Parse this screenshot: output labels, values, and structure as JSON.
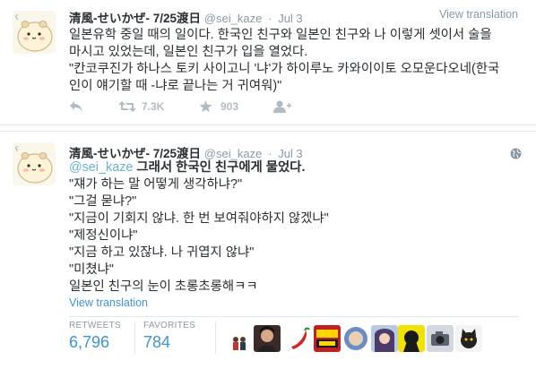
{
  "tweet1": {
    "name": "清風-せいかぜ- 7/25渡日",
    "handle": "@sei_kaze",
    "time": "Jul 3",
    "view_translation": "View translation",
    "lines": [
      "일본유학 중일 때의 일이다. 한국인 친구와 일본인 친구와 나 이렇게 셋이서 술을",
      "마시고 있었는데, 일본인 친구가 입을 열었다.",
      "\"칸코쿠진가 하나스 토키 사이고니 '냐'가 하이루노 카와이이토 오모운다오네(한국",
      "인이 얘기할 때 -냐로 끝나는 거 귀여워)\""
    ],
    "actions": {
      "reply_icon": "reply-icon",
      "retweet_icon": "retweet-icon",
      "retweet_count": "7.3K",
      "favorite_icon": "star-icon",
      "favorite_count": "903",
      "follow_icon": "follow-icon"
    }
  },
  "tweet2": {
    "name": "清風-せいかぜ- 7/25渡日",
    "handle": "@sei_kaze",
    "time": "Jul 3",
    "mention": "@sei_kaze",
    "first_line_rest": " 그래서 한국인 친구에게 물었다.",
    "lines": [
      "\"쟤가 하는 말 어떻게 생각하냐?\"",
      "\"그걸 묻냐?\"",
      "\"지금이 기회지 않냐. 한 번 보여줘야하지 않겠냐\"",
      "\"제정신이냐\"",
      "\"지금 하고 있잖냐. 나 귀엽지 않냐\"",
      "\"미쳤냐\"",
      "일본인 친구의 눈이 초롱초롱해ㅋㅋ"
    ],
    "view_translation": "View translation",
    "retweets_label": "RETWEETS",
    "retweets_value": "6,796",
    "favorites_label": "FAVORITES",
    "favorites_value": "784"
  },
  "colors": {
    "link": "#3b94d9",
    "muted": "#8899a6",
    "text": "#292f33",
    "action": "#b1bbc3",
    "divider": "#e1e8ed"
  }
}
